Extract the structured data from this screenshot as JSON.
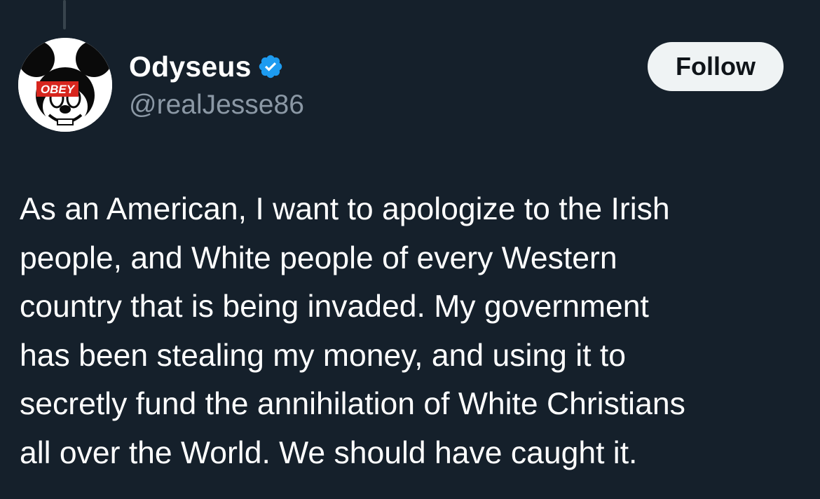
{
  "author": {
    "display_name": "Odyseus",
    "handle": "@realJesse86",
    "verified": true,
    "avatar_text": "OBEY"
  },
  "actions": {
    "follow_label": "Follow"
  },
  "tweet": {
    "lines": [
      "As an American, I want to apologize to the Irish",
      "people, and White people of every Western",
      "country that is being invaded. My government",
      "has been stealing my money, and using it to",
      "secretly fund the annihilation of White Christians",
      "all over the World. We should have caught it."
    ]
  },
  "colors": {
    "background": "#15202b",
    "verified_badge": "#1d9bf0",
    "handle": "#8b98a5",
    "follow_button_bg": "#eff3f4",
    "obey_red": "#d7261e"
  },
  "icons": {
    "verified": "verified-badge-icon"
  }
}
